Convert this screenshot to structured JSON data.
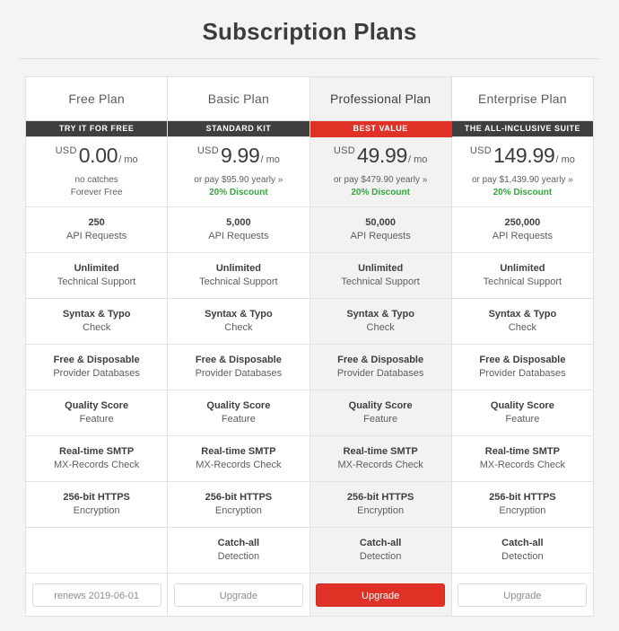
{
  "page": {
    "title": "Subscription Plans",
    "background_color": "#f4f4f4"
  },
  "colors": {
    "accent_red": "#e03127",
    "badge_dark": "#3f3f3f",
    "discount_green": "#37a53f",
    "featured_tint": "#f2f2f2"
  },
  "plans": [
    {
      "name": "Free Plan",
      "badge": "TRY IT FOR FREE",
      "featured": false,
      "currency": "USD",
      "amount": "0.00",
      "period": "/ mo",
      "note_line1": "no catches",
      "note_line2": "Forever Free",
      "discount": "",
      "button_label": "renews 2019-06-01",
      "button_style": "outline",
      "features": [
        {
          "main": "250",
          "sub": "API Requests"
        },
        {
          "main": "Unlimited",
          "sub": "Technical Support"
        },
        {
          "main": "Syntax & Typo",
          "sub": "Check"
        },
        {
          "main": "Free & Disposable",
          "sub": "Provider Databases"
        },
        {
          "main": "Quality Score",
          "sub": "Feature"
        },
        {
          "main": "Real-time SMTP",
          "sub": "MX-Records Check"
        },
        {
          "main": "256-bit HTTPS",
          "sub": "Encryption"
        },
        {
          "main": "",
          "sub": ""
        }
      ]
    },
    {
      "name": "Basic Plan",
      "badge": "STANDARD KIT",
      "featured": false,
      "currency": "USD",
      "amount": "9.99",
      "period": "/ mo",
      "note_line1": "or pay $95.90 yearly »",
      "note_line2": "",
      "discount": "20% Discount",
      "button_label": "Upgrade",
      "button_style": "outline",
      "features": [
        {
          "main": "5,000",
          "sub": "API Requests"
        },
        {
          "main": "Unlimited",
          "sub": "Technical Support"
        },
        {
          "main": "Syntax & Typo",
          "sub": "Check"
        },
        {
          "main": "Free & Disposable",
          "sub": "Provider Databases"
        },
        {
          "main": "Quality Score",
          "sub": "Feature"
        },
        {
          "main": "Real-time SMTP",
          "sub": "MX-Records Check"
        },
        {
          "main": "256-bit HTTPS",
          "sub": "Encryption"
        },
        {
          "main": "Catch-all",
          "sub": "Detection"
        }
      ]
    },
    {
      "name": "Professional Plan",
      "badge": "BEST VALUE",
      "featured": true,
      "currency": "USD",
      "amount": "49.99",
      "period": "/ mo",
      "note_line1": "or pay $479.90 yearly »",
      "note_line2": "",
      "discount": "20% Discount",
      "button_label": "Upgrade",
      "button_style": "primary",
      "features": [
        {
          "main": "50,000",
          "sub": "API Requests"
        },
        {
          "main": "Unlimited",
          "sub": "Technical Support"
        },
        {
          "main": "Syntax & Typo",
          "sub": "Check"
        },
        {
          "main": "Free & Disposable",
          "sub": "Provider Databases"
        },
        {
          "main": "Quality Score",
          "sub": "Feature"
        },
        {
          "main": "Real-time SMTP",
          "sub": "MX-Records Check"
        },
        {
          "main": "256-bit HTTPS",
          "sub": "Encryption"
        },
        {
          "main": "Catch-all",
          "sub": "Detection"
        }
      ]
    },
    {
      "name": "Enterprise Plan",
      "badge": "THE ALL-INCLUSIVE SUITE",
      "featured": false,
      "currency": "USD",
      "amount": "149.99",
      "period": "/ mo",
      "note_line1": "or pay $1,439.90 yearly »",
      "note_line2": "",
      "discount": "20% Discount",
      "button_label": "Upgrade",
      "button_style": "outline",
      "features": [
        {
          "main": "250,000",
          "sub": "API Requests"
        },
        {
          "main": "Unlimited",
          "sub": "Technical Support"
        },
        {
          "main": "Syntax & Typo",
          "sub": "Check"
        },
        {
          "main": "Free & Disposable",
          "sub": "Provider Databases"
        },
        {
          "main": "Quality Score",
          "sub": "Feature"
        },
        {
          "main": "Real-time SMTP",
          "sub": "MX-Records Check"
        },
        {
          "main": "256-bit HTTPS",
          "sub": "Encryption"
        },
        {
          "main": "Catch-all",
          "sub": "Detection"
        }
      ]
    }
  ]
}
